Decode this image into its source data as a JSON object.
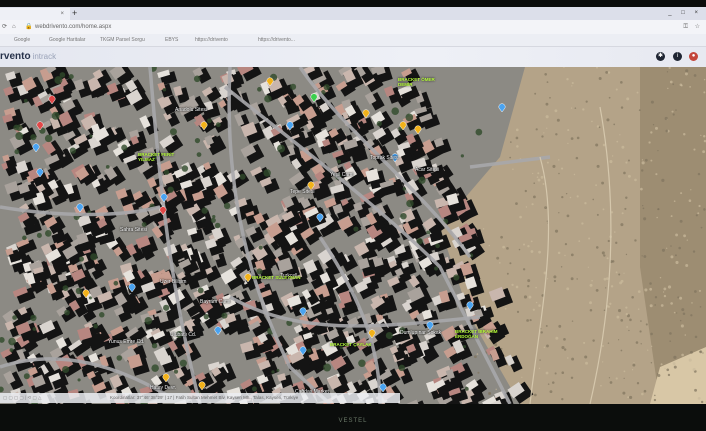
{
  "browser": {
    "tab_title": "",
    "tab_close": "×",
    "new_tab": "+",
    "window_controls": "_ □ ×",
    "url": "webdrivento.com/home.aspx",
    "bookmarks": [
      "Google",
      "Google Haritalar",
      "TKGM Parsel Sorgu",
      "EBYS",
      "https://drivento",
      "https://drivento..."
    ]
  },
  "app": {
    "logo_main": "rvento",
    "logo_sub": "intrack",
    "header_icons": [
      "settings-icon",
      "info-icon",
      "user-icon"
    ]
  },
  "map": {
    "type": "satellite",
    "labels": [
      "Sahra Sitesi",
      "Uzer Bilişim",
      "Yeşil Cami",
      "Hatay Devr.",
      "Turkcell",
      "Çağdaş Market",
      "Toprak Sitesi",
      "Dumlupınar Sokak",
      "Tepe Sitesi",
      "Acar Sitesi",
      "Ulubatlı Cd.",
      "Yunus Emre Cd.",
      "Anadolu Sitesi",
      "Bayram Cami"
    ],
    "vehicle_labels": [
      "BRACKET FERİT YILMAZ",
      "BRACKET ÖMER DEMİR",
      "BRACKET SÜLEYMAN",
      "BRACKET ÇAYLAK",
      "BRACKET İBRAHİM ERDOĞAN"
    ],
    "colors": {
      "vehicle_label": "#b8ff3a",
      "pin_yellow": "#f2b21a",
      "pin_blue": "#4aa3f0",
      "pin_red": "#e04848",
      "pin_green": "#3ccf4e"
    }
  },
  "status_bar": {
    "text": "Koordinatlar: 37°46' 38°29' | 17 | Fatih Sultan Mehmet Blv, Kayseri Mh., Talas, Kayseri, Türkiye"
  },
  "taskbar": {
    "tray": "^ ⊡ 🔊"
  },
  "monitor": {
    "brand": "VESTEL"
  }
}
